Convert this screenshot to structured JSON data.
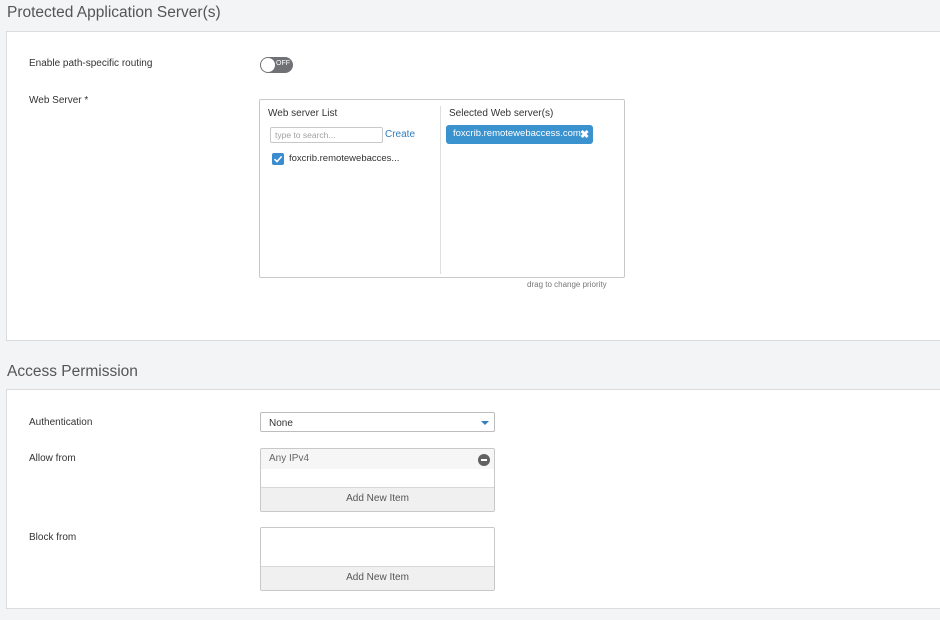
{
  "protected_section": {
    "title": "Protected Application Server(s)",
    "path_routing_label": "Enable path-specific routing",
    "toggle_text": "OFF",
    "web_server_label": "Web Server *",
    "web_server_list_header": "Web server List",
    "search_placeholder": "type to search...",
    "create_label": "Create",
    "list_items": [
      {
        "label": "foxcrib.remotewebacces...",
        "checked": true
      }
    ],
    "selected_header": "Selected Web server(s)",
    "selected_items": [
      {
        "label": "foxcrib.remotewebaccess.com"
      }
    ],
    "drag_hint": "drag to change priority"
  },
  "access_section": {
    "title": "Access Permission",
    "authentication_label": "Authentication",
    "authentication_value": "None",
    "allow_from_label": "Allow from",
    "allow_items": [
      "Any IPv4"
    ],
    "add_new_item_label": "Add New Item",
    "block_from_label": "Block from",
    "block_add_new_item_label": "Add New Item"
  },
  "colors": {
    "accent": "#3a92cf",
    "link": "#2f7fc1",
    "toggle_off": "#6f7175"
  },
  "icons": [
    "check-icon",
    "close-icon",
    "chevron-down-icon",
    "remove-icon"
  ]
}
